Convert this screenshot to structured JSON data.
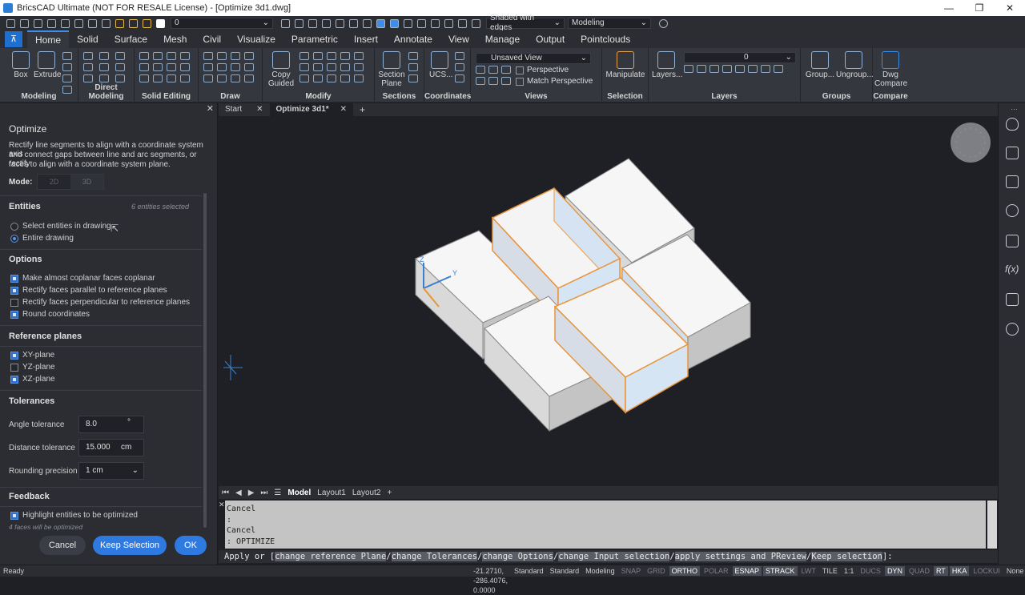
{
  "window": {
    "title": "BricsCAD Ultimate (NOT FOR RESALE License) - [Optimize 3d1.dwg]",
    "controls": [
      "—",
      "❐",
      "✕"
    ]
  },
  "qat": {
    "layer_value": "0",
    "visual_style": "Shaded with edges",
    "workspace": "Modeling"
  },
  "ribbon_tabs": [
    "Home",
    "Solid",
    "Surface",
    "Mesh",
    "Civil",
    "Visualize",
    "Parametric",
    "Insert",
    "Annotate",
    "View",
    "Manage",
    "Output",
    "Pointclouds"
  ],
  "ribbon": {
    "modeling": {
      "title": "Modeling",
      "box": "Box",
      "extrude": "Extrude"
    },
    "direct_modeling": {
      "title": "Direct Modeling"
    },
    "solid_editing": {
      "title": "Solid Editing"
    },
    "draw": {
      "title": "Draw"
    },
    "modify": {
      "title": "Modify",
      "copy_guided": "Copy Guided"
    },
    "sections": {
      "title": "Sections",
      "section_plane": "Section Plane"
    },
    "coordinates": {
      "title": "Coordinates",
      "ucs": "UCS..."
    },
    "views": {
      "title": "Views",
      "view_select": "Unsaved View",
      "perspective": "Perspective",
      "match_perspective": "Match Perspective"
    },
    "selection": {
      "title": "Selection",
      "manipulate": "Manipulate"
    },
    "layers": {
      "title": "Layers",
      "layers": "Layers...",
      "layer_value": "0"
    },
    "groups": {
      "title": "Groups",
      "group": "Group...",
      "ungroup": "Ungroup..."
    },
    "compare": {
      "title": "Compare",
      "dwg_compare": "Dwg Compare"
    }
  },
  "panel": {
    "title": "Optimize",
    "description": [
      "Rectify line segments to align with a coordinate system axis",
      "and connect gaps between line and arc segments, or rectify",
      "faces to align with a coordinate system plane."
    ],
    "mode_label": "Mode:",
    "mode_2d": "2D",
    "mode_3d": "3D",
    "entities_heading": "Entities",
    "entities_count": "6 entities selected",
    "select_in_drawing": "Select entities in drawing",
    "entire_drawing": "Entire drawing",
    "options_heading": "Options",
    "opt1": "Make almost coplanar faces coplanar",
    "opt2": "Rectify faces parallel to reference planes",
    "opt3": "Rectify faces perpendicular to reference planes",
    "opt4": "Round coordinates",
    "refplanes_heading": "Reference planes",
    "xy": "XY-plane",
    "yz": "YZ-plane",
    "xz": "XZ-plane",
    "tolerances_heading": "Tolerances",
    "angle_label": "Angle tolerance",
    "angle_value": "8.0",
    "angle_unit": "°",
    "distance_label": "Distance tolerance",
    "distance_value": "15.000",
    "distance_unit": "cm",
    "rounding_label": "Rounding precision",
    "rounding_value": "1 cm",
    "feedback_heading": "Feedback",
    "highlight": "Highlight entities to be optimized",
    "faces_note": "4 faces will be optimized",
    "cancel": "Cancel",
    "keep": "Keep Selection",
    "ok": "OK"
  },
  "doc_tabs": {
    "start": "Start",
    "current": "Optimize 3d1*"
  },
  "viewport": {
    "ucs_z": "Z",
    "ucs_y": "Y"
  },
  "layout_tabs": [
    "Model",
    "Layout1",
    "Layout2"
  ],
  "command_history": [
    "Cancel",
    ":",
    "Cancel",
    ": OPTIMIZE"
  ],
  "command_prompt": {
    "prefix": "Apply or [",
    "options": [
      "change reference Plane",
      "change Tolerances",
      "change Options",
      "change Input selection",
      "apply settings and PReview",
      "Keep selection"
    ],
    "suffix": "]:"
  },
  "status": {
    "ready": "Ready",
    "coords": "-21.2710, -286.4076, 0.0000",
    "standard1": "Standard",
    "standard2": "Standard",
    "modeling": "Modeling",
    "toggles": [
      "SNAP",
      "GRID",
      "ORTHO",
      "POLAR",
      "ESNAP",
      "STRACK",
      "LWT",
      "TILE",
      "1:1",
      "DUCS",
      "DYN",
      "QUAD",
      "RT",
      "HKA",
      "LOCKUI",
      "None"
    ]
  },
  "colors": {
    "accent": "#2e7ae0",
    "highlight_edge": "#e8943a",
    "background": "#1e2026"
  }
}
